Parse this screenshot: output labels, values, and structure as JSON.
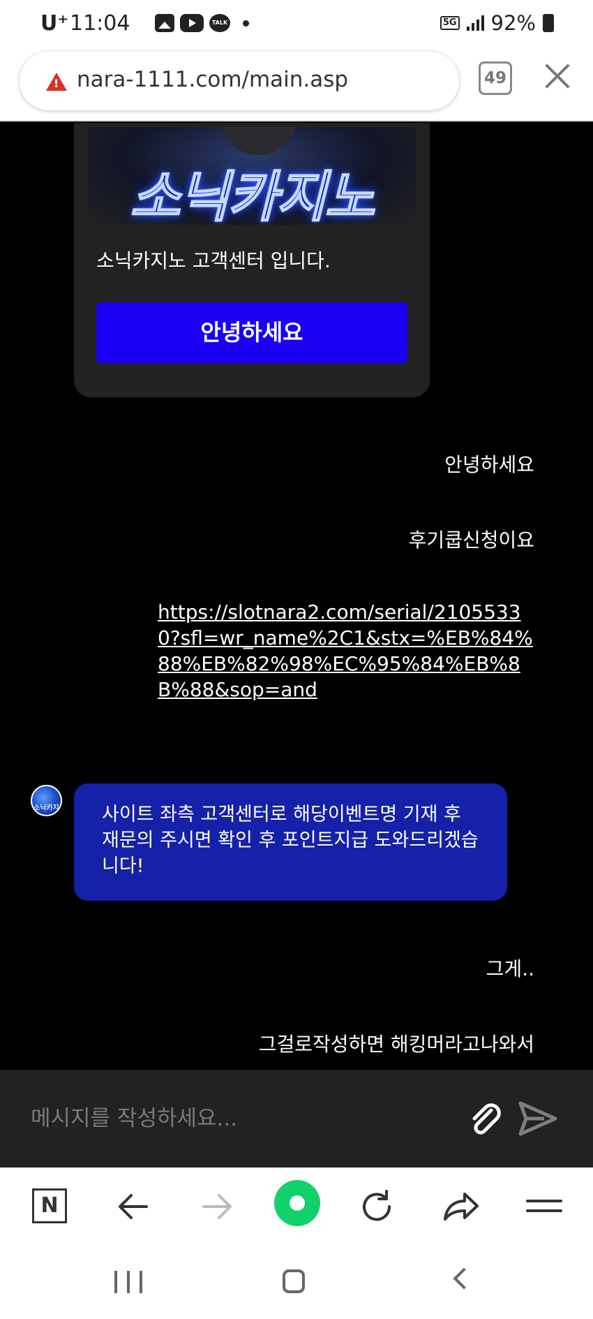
{
  "status_bar": {
    "carrier": "U⁺",
    "time": "11:04",
    "talk_badge": "TALK",
    "network": "5G",
    "battery": "92%"
  },
  "browser": {
    "url": "nara-1111.com/main.asp",
    "tab_count": "49"
  },
  "chat": {
    "logo_text": "소닉카지노",
    "intro": "소닉카지노 고객센터 입니다.",
    "greeting_button": "안녕하세요",
    "user_messages": [
      "안녕하세요",
      "후기쿱신청이요"
    ],
    "link_message": "https://slotnara2.com/serial/21055330?sfl=wr_name%2C1&stx=%EB%84%88%EB%82%98%EC%95%84%EB%8B%88&sop=and",
    "avatar_label": "소닉카지",
    "bot_reply": "사이트 좌측 고객센터로 해당이벤트명 기재 후 재문의 주시면 확인 후 포인트지급 도와드리겠습니다!",
    "user_messages_after": [
      "그게..",
      "그걸로작성하면 해킹머라고나와서"
    ]
  },
  "composer": {
    "placeholder": "메시지를 작성하세요..."
  },
  "toolbar": {
    "naver_label": "N"
  }
}
